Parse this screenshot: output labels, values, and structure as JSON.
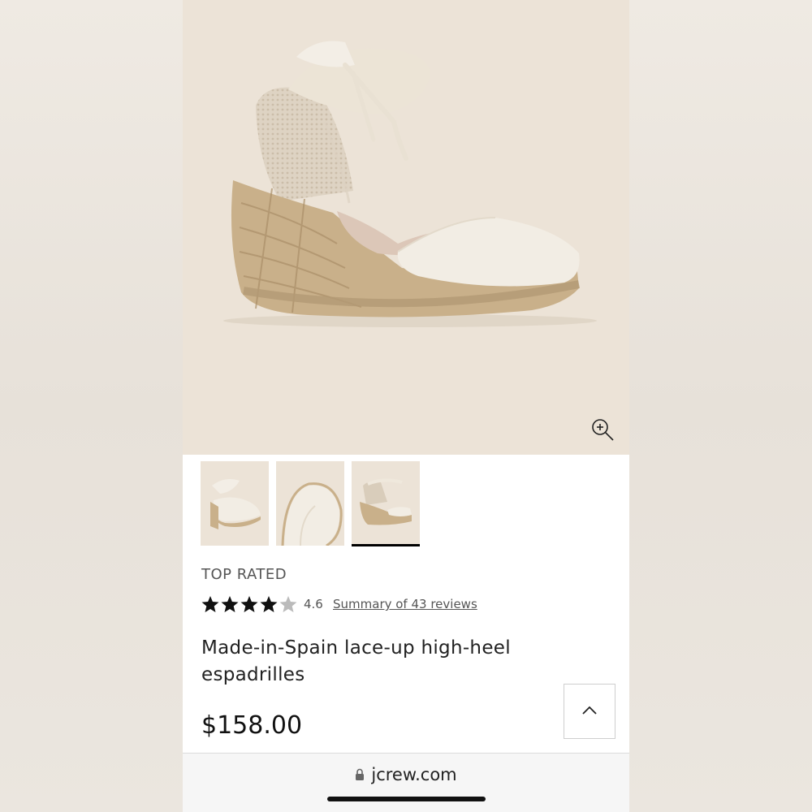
{
  "product": {
    "badge": "TOP RATED",
    "rating_value": "4.6",
    "rating_stars": 4.6,
    "reviews_link": "Summary of 43 reviews",
    "title": "Made-in-Spain lace-up high-heel espadrilles",
    "price": "$158.00"
  },
  "gallery": {
    "active_thumbnail": 3,
    "thumbnails": [
      "side view",
      "toe detail",
      "heel view"
    ]
  },
  "browser": {
    "url": "jcrew.com"
  },
  "icons": {
    "zoom": "zoom-in-icon",
    "back_to_top": "chevron-up-icon",
    "lock": "lock-icon"
  },
  "colors": {
    "hero_background": "#ece3d7",
    "canvas": "#f2ede4",
    "jute": "#c9b08a",
    "text": "#222222"
  }
}
